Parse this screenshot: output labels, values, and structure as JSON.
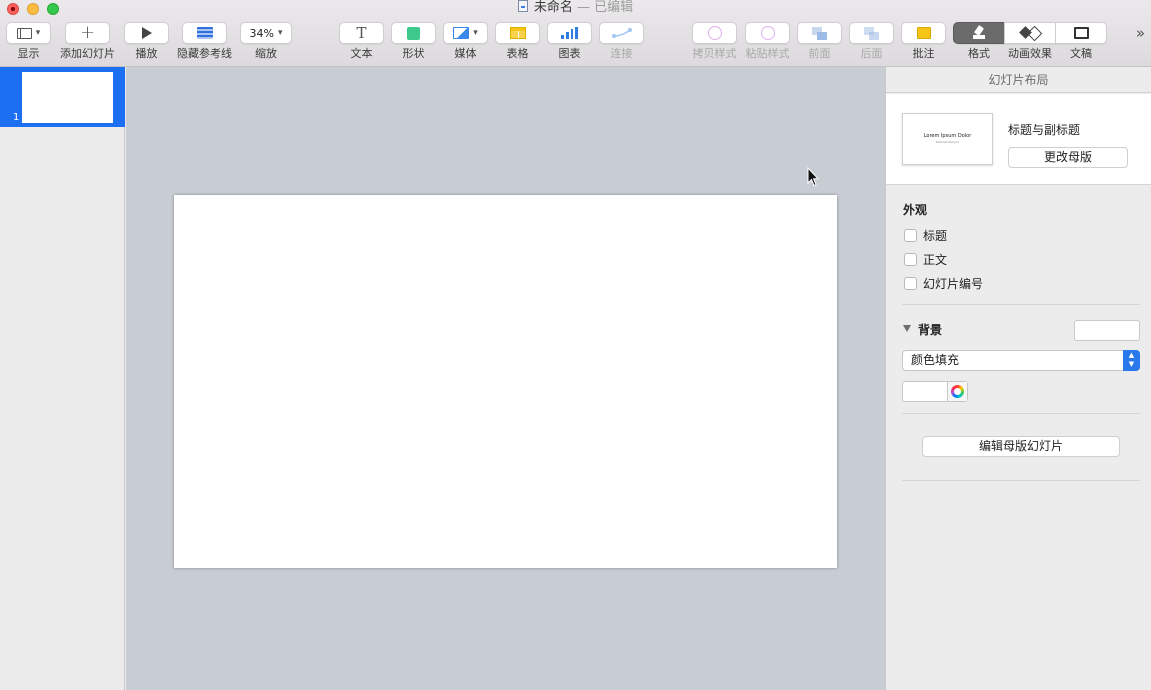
{
  "window": {
    "title": "未命名",
    "edited_label": "— 已编辑"
  },
  "toolbar": {
    "view": {
      "label": "显示",
      "icon": "sidebar-icon"
    },
    "add_slide": {
      "label": "添加幻灯片",
      "icon": "plus-icon"
    },
    "play": {
      "label": "播放",
      "icon": "play-icon"
    },
    "hide_guides": {
      "label": "隐藏参考线",
      "icon": "guides-icon"
    },
    "zoom": {
      "label": "缩放",
      "value": "34%"
    },
    "text": {
      "label": "文本",
      "icon": "text-icon"
    },
    "shape": {
      "label": "形状",
      "icon": "shape-icon"
    },
    "media": {
      "label": "媒体",
      "icon": "media-icon"
    },
    "table": {
      "label": "表格",
      "icon": "table-icon"
    },
    "chart": {
      "label": "图表",
      "icon": "chart-icon"
    },
    "connect": {
      "label": "连接",
      "icon": "connect-icon",
      "disabled": true
    },
    "copy_style": {
      "label": "拷贝样式",
      "icon": "copy-style-icon",
      "disabled": true
    },
    "paste_style": {
      "label": "粘贴样式",
      "icon": "paste-style-icon",
      "disabled": true
    },
    "front": {
      "label": "前面",
      "icon": "bring-front-icon",
      "disabled": true
    },
    "back": {
      "label": "后面",
      "icon": "send-back-icon",
      "disabled": true
    },
    "comment": {
      "label": "批注",
      "icon": "comment-icon"
    },
    "format": {
      "label": "格式",
      "icon": "format-brush-icon",
      "active": true
    },
    "animate": {
      "label": "动画效果",
      "icon": "animate-icon"
    },
    "document": {
      "label": "文稿",
      "icon": "document-icon"
    }
  },
  "navigator": {
    "slides": [
      {
        "number": "1",
        "selected": true
      }
    ]
  },
  "inspector": {
    "header": "幻灯片布局",
    "layout": {
      "name": "标题与副标题",
      "change_master_button": "更改母版",
      "thumb_title": "Lorem Ipsum Dolor",
      "thumb_subtitle": "Sitamet tempor"
    },
    "appearance": {
      "title": "外观",
      "options": [
        {
          "label": "标题",
          "checked": false
        },
        {
          "label": "正文",
          "checked": false
        },
        {
          "label": "幻灯片编号",
          "checked": false
        }
      ]
    },
    "background": {
      "title": "背景",
      "fill_type": "颜色填充",
      "color": "#ffffff"
    },
    "edit_master_button": "编辑母版幻灯片"
  },
  "colors": {
    "selection_blue": "#1d6ff2",
    "canvas_bg": "#c8cdd4",
    "accent_blue": "#2a79ec"
  }
}
